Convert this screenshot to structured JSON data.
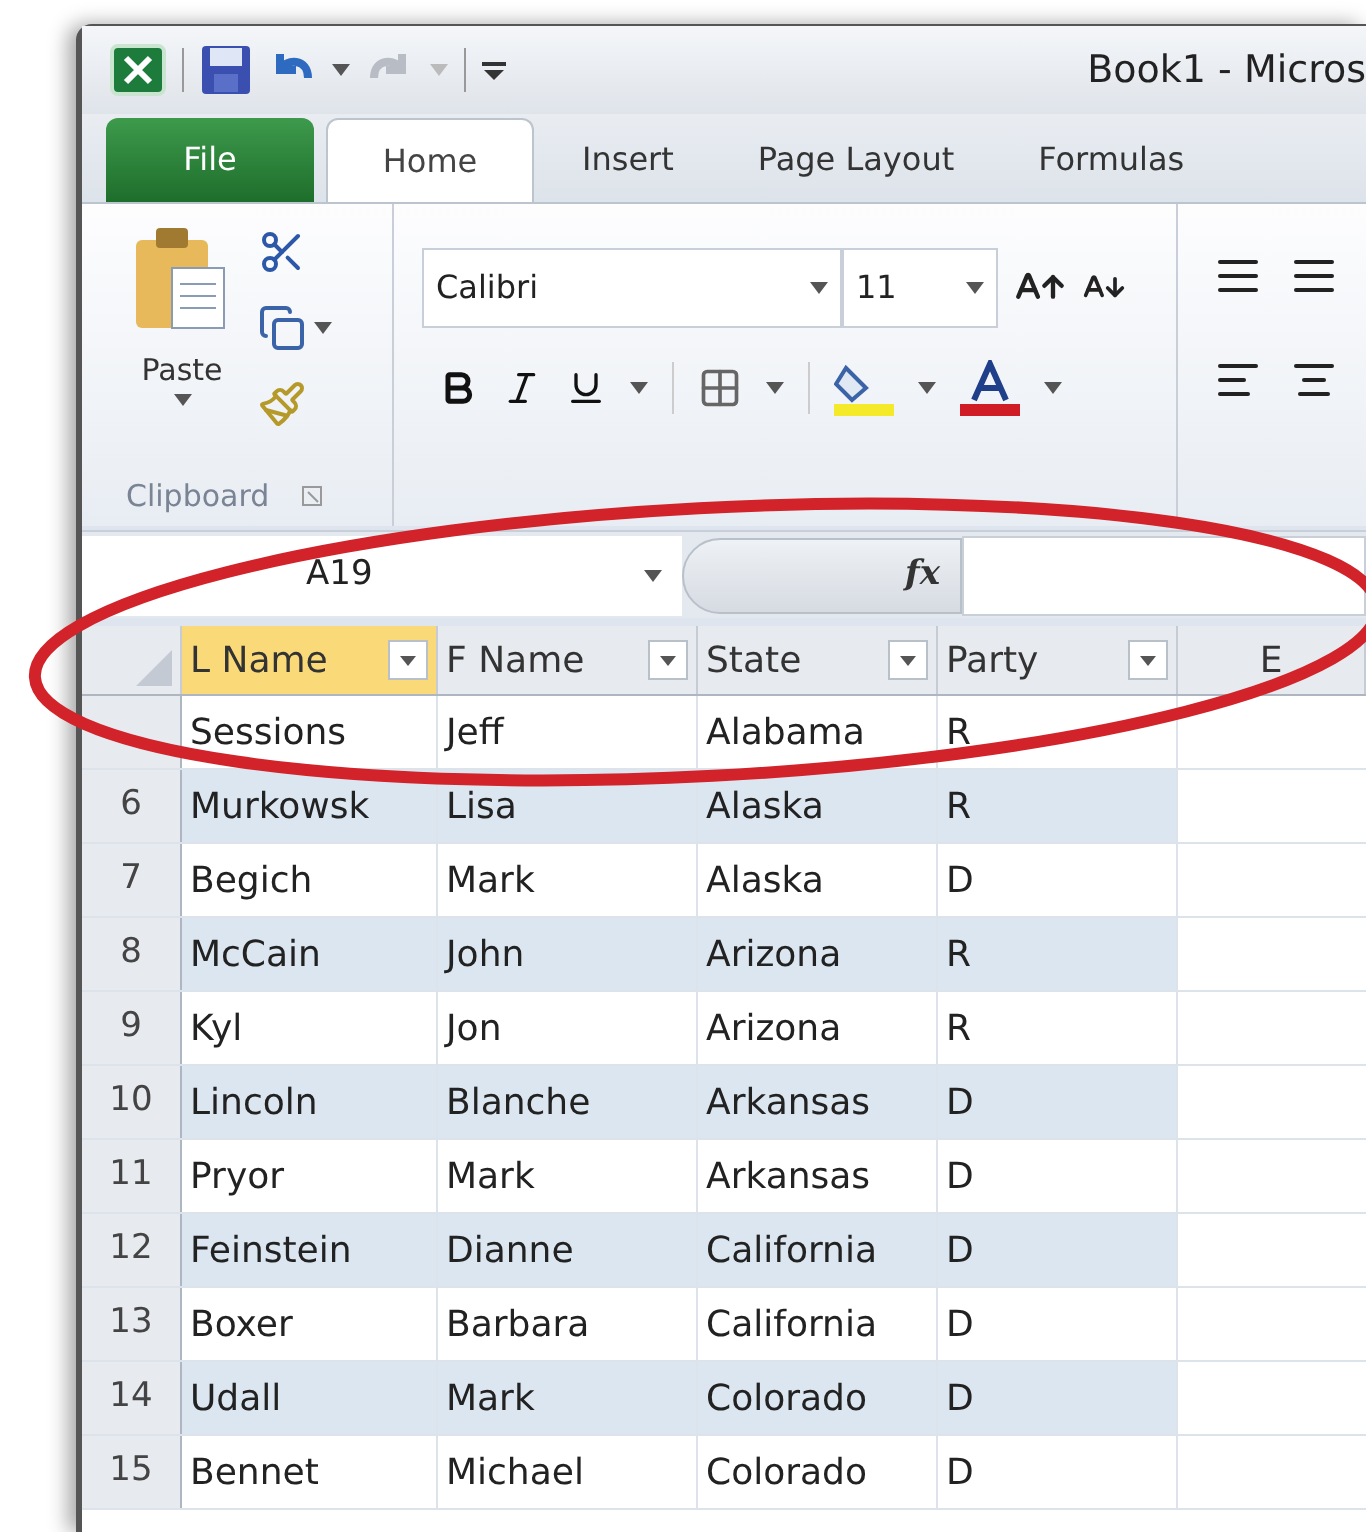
{
  "window": {
    "title": "Book1  -  Micros"
  },
  "tabs": [
    {
      "label": "File",
      "kind": "file",
      "selected": false
    },
    {
      "label": "Home",
      "kind": "tab",
      "selected": true
    },
    {
      "label": "Insert",
      "kind": "tab",
      "selected": false
    },
    {
      "label": "Page Layout",
      "kind": "tab",
      "selected": false
    },
    {
      "label": "Formulas",
      "kind": "tab",
      "selected": false
    }
  ],
  "ribbon": {
    "paste_label": "Paste",
    "clipboard_label": "Clipboard",
    "font_name": "Calibri",
    "font_size": "11"
  },
  "formula_bar": {
    "name_box": "A19",
    "fx": "fx"
  },
  "columns": [
    {
      "label": "L Name",
      "filter": true,
      "selected": true
    },
    {
      "label": "F Name",
      "filter": true,
      "selected": false
    },
    {
      "label": "State",
      "filter": true,
      "selected": false
    },
    {
      "label": "Party",
      "filter": true,
      "selected": false
    },
    {
      "label": "E",
      "filter": false,
      "selected": false
    }
  ],
  "rows": [
    {
      "banded": false,
      "cells": [
        "Sessions",
        "Jeff",
        "Alabama",
        "R"
      ]
    },
    {
      "number": "6",
      "banded": true,
      "cells": [
        "Murkowsk",
        "Lisa",
        "Alaska",
        "R"
      ]
    },
    {
      "number": "7",
      "banded": false,
      "cells": [
        "Begich",
        "Mark",
        "Alaska",
        "D"
      ]
    },
    {
      "number": "8",
      "banded": true,
      "cells": [
        "McCain",
        "John",
        "Arizona",
        "R"
      ]
    },
    {
      "number": "9",
      "banded": false,
      "cells": [
        "Kyl",
        "Jon",
        "Arizona",
        "R"
      ]
    },
    {
      "number": "10",
      "banded": true,
      "cells": [
        "Lincoln",
        "Blanche",
        "Arkansas",
        "D"
      ]
    },
    {
      "number": "11",
      "banded": false,
      "cells": [
        "Pryor",
        "Mark",
        "Arkansas",
        "D"
      ]
    },
    {
      "number": "12",
      "banded": true,
      "cells": [
        "Feinstein",
        "Dianne",
        "California",
        "D"
      ]
    },
    {
      "number": "13",
      "banded": false,
      "cells": [
        "Boxer",
        "Barbara",
        "California",
        "D"
      ]
    },
    {
      "number": "14",
      "banded": true,
      "cells": [
        "Udall",
        "Mark",
        "Colorado",
        "D"
      ]
    },
    {
      "number": "15",
      "banded": false,
      "cells": [
        "Bennet",
        "Michael",
        "Colorado",
        "D"
      ]
    }
  ]
}
